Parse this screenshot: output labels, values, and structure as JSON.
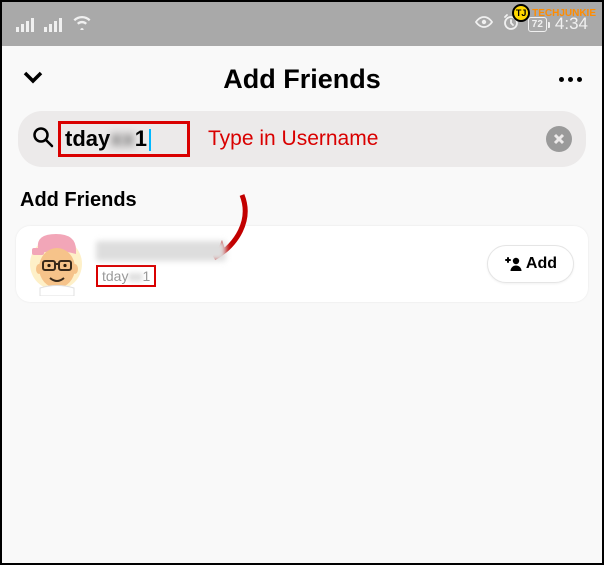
{
  "watermark": {
    "badge": "TJ",
    "text": "TECHJUNKIE"
  },
  "status": {
    "battery": "72",
    "time": "4:34"
  },
  "header": {
    "title": "Add Friends"
  },
  "search": {
    "visibleText": "tday",
    "trailing": "1"
  },
  "annotation": {
    "text": "Type in Username"
  },
  "section": {
    "title": "Add Friends"
  },
  "result": {
    "usernamePrefix": "tday",
    "usernameSuffix": "1",
    "addLabel": "Add"
  }
}
